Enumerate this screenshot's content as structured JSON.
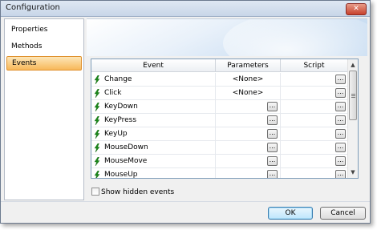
{
  "window": {
    "title": "Configuration"
  },
  "icons": {
    "close": "close-x-icon",
    "event": "lightning-bolt-icon",
    "ellipsis": "ellipsis-icon"
  },
  "colors": {
    "active_item": "#f7b85a",
    "event_icon": "#1a8a1a",
    "close_button": "#c7412c"
  },
  "sidebar": {
    "items": [
      {
        "label": "Properties"
      },
      {
        "label": "Methods"
      },
      {
        "label": "Events",
        "selected": true
      }
    ]
  },
  "grid": {
    "columns": [
      "Event",
      "Parameters",
      "Script"
    ],
    "rows": [
      {
        "event": "Change",
        "parameters": "<None>"
      },
      {
        "event": "Click",
        "parameters": "<None>"
      },
      {
        "event": "KeyDown",
        "parameters": ""
      },
      {
        "event": "KeyPress",
        "parameters": ""
      },
      {
        "event": "KeyUp",
        "parameters": ""
      },
      {
        "event": "MouseDown",
        "parameters": ""
      },
      {
        "event": "MouseMove",
        "parameters": ""
      },
      {
        "event": "MouseUp",
        "parameters": ""
      }
    ],
    "ellipsis": "..."
  },
  "show_hidden": {
    "label": "Show hidden events",
    "checked": false
  },
  "buttons": {
    "ok": "OK",
    "cancel": "Cancel"
  }
}
